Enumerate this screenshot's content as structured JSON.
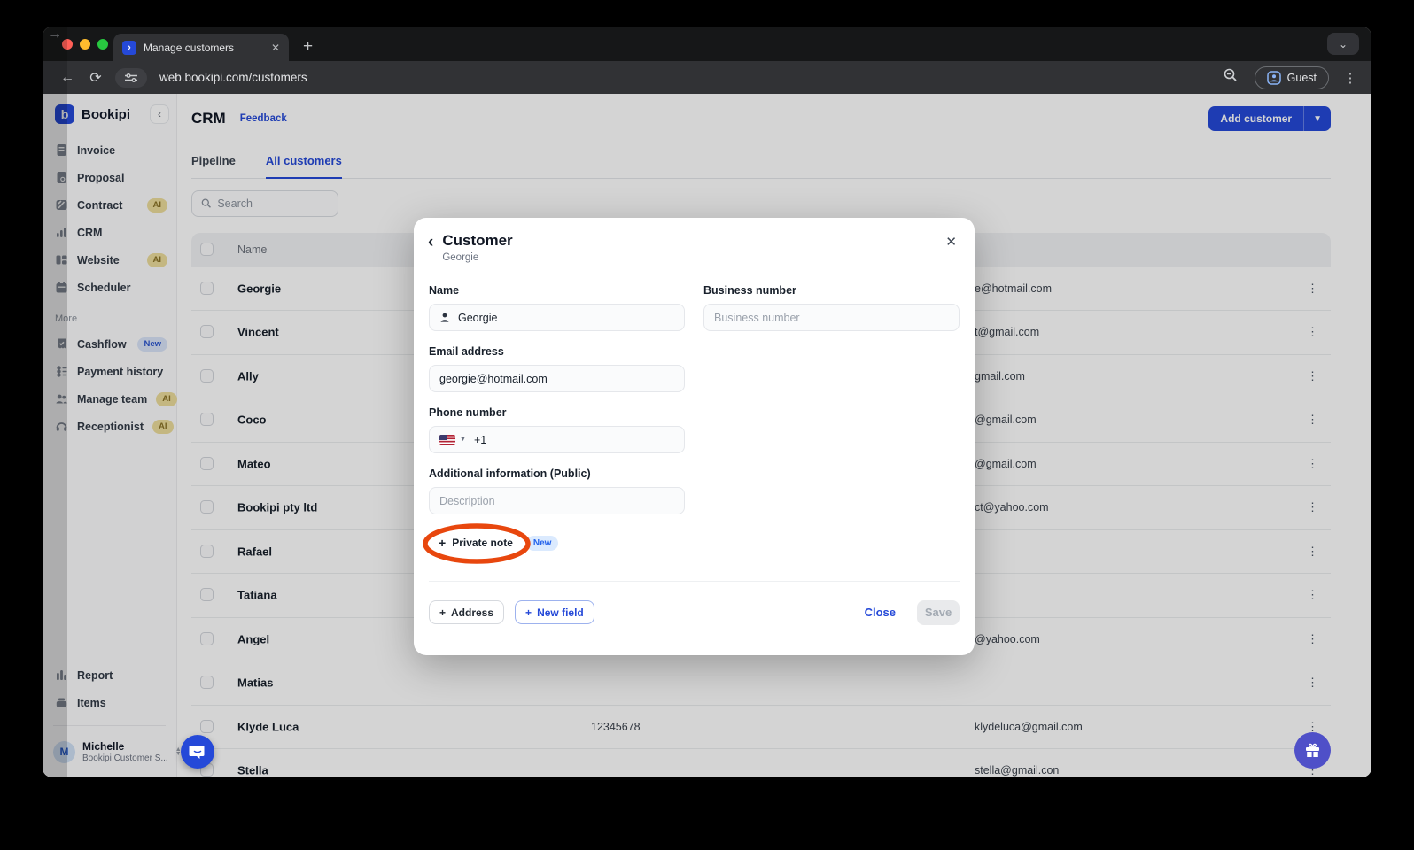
{
  "browser": {
    "tab_title": "Manage customers",
    "new_tab": "+",
    "close_tab": "✕",
    "url": "web.bookipi.com/customers",
    "guest_label": "Guest"
  },
  "sidebar": {
    "brand": "Bookipi",
    "logo_glyph": "b",
    "collapse_glyph": "‹",
    "items": [
      {
        "label": "Invoice",
        "icon": "invoice-icon",
        "badge": ""
      },
      {
        "label": "Proposal",
        "icon": "proposal-icon",
        "badge": ""
      },
      {
        "label": "Contract",
        "icon": "contract-icon",
        "badge": "AI"
      },
      {
        "label": "CRM",
        "icon": "crm-icon",
        "badge": ""
      },
      {
        "label": "Website",
        "icon": "website-icon",
        "badge": "AI"
      },
      {
        "label": "Scheduler",
        "icon": "scheduler-icon",
        "badge": ""
      }
    ],
    "section_label": "More",
    "more_items": [
      {
        "label": "Cashflow",
        "icon": "cashflow-icon",
        "badge": "New"
      },
      {
        "label": "Payment history",
        "icon": "payment-history-icon",
        "badge": ""
      },
      {
        "label": "Manage team",
        "icon": "manage-team-icon",
        "badge": "AI"
      },
      {
        "label": "Receptionist",
        "icon": "receptionist-icon",
        "badge": "AI"
      }
    ],
    "bottom_items": [
      {
        "label": "Report",
        "icon": "report-icon"
      },
      {
        "label": "Items",
        "icon": "items-icon"
      }
    ],
    "user": {
      "initial": "M",
      "name": "Michelle",
      "org": "Bookipi Customer S..."
    }
  },
  "header": {
    "title": "CRM",
    "feedback_link": "Feedback",
    "add_customer_label": "Add customer"
  },
  "tabs": [
    {
      "label": "Pipeline",
      "active": false
    },
    {
      "label": "All customers",
      "active": true
    }
  ],
  "search": {
    "placeholder": "Search"
  },
  "table": {
    "name_header": "Name",
    "rows": [
      {
        "name": "Georgie",
        "phone": "",
        "email": "e@hotmail.com"
      },
      {
        "name": "Vincent",
        "phone": "",
        "email": "t@gmail.com"
      },
      {
        "name": "Ally",
        "phone": "",
        "email": "gmail.com"
      },
      {
        "name": "Coco",
        "phone": "",
        "email": "@gmail.com"
      },
      {
        "name": "Mateo",
        "phone": "",
        "email": "@gmail.com"
      },
      {
        "name": "Bookipi pty ltd",
        "phone": "",
        "email": "ct@yahoo.com"
      },
      {
        "name": "Rafael",
        "phone": "",
        "email": ""
      },
      {
        "name": "Tatiana",
        "phone": "",
        "email": ""
      },
      {
        "name": "Angel",
        "phone": "",
        "email": "@yahoo.com"
      },
      {
        "name": "Matias",
        "phone": "",
        "email": ""
      },
      {
        "name": "Klyde Luca",
        "phone": "12345678",
        "email": "klydeluca@gmail.com"
      },
      {
        "name": "Stella",
        "phone": "",
        "email": "stella@gmail.con"
      }
    ]
  },
  "modal": {
    "title": "Customer",
    "subtitle": "Georgie",
    "back_glyph": "‹",
    "close_glyph": "✕",
    "fields": {
      "name": {
        "label": "Name",
        "value": "Georgie"
      },
      "business": {
        "label": "Business number",
        "placeholder": "Business number"
      },
      "email": {
        "label": "Email address",
        "value": "georgie@hotmail.com"
      },
      "phone": {
        "label": "Phone number",
        "dial_code": "+1"
      },
      "additional": {
        "label": "Additional information (Public)",
        "placeholder": "Description"
      }
    },
    "private_note": {
      "plus": "+",
      "label": "Private note",
      "badge": "New"
    },
    "footer": {
      "address_label": "Address",
      "new_field_label": "New field",
      "close_label": "Close",
      "save_label": "Save"
    }
  },
  "colors": {
    "accent_blue": "#2549d8",
    "annotation_orange": "#e8470e",
    "ai_badge_bg": "#ecdc9c",
    "new_badge_bg": "#dbeafe",
    "gift_fab": "#4f50c8"
  }
}
